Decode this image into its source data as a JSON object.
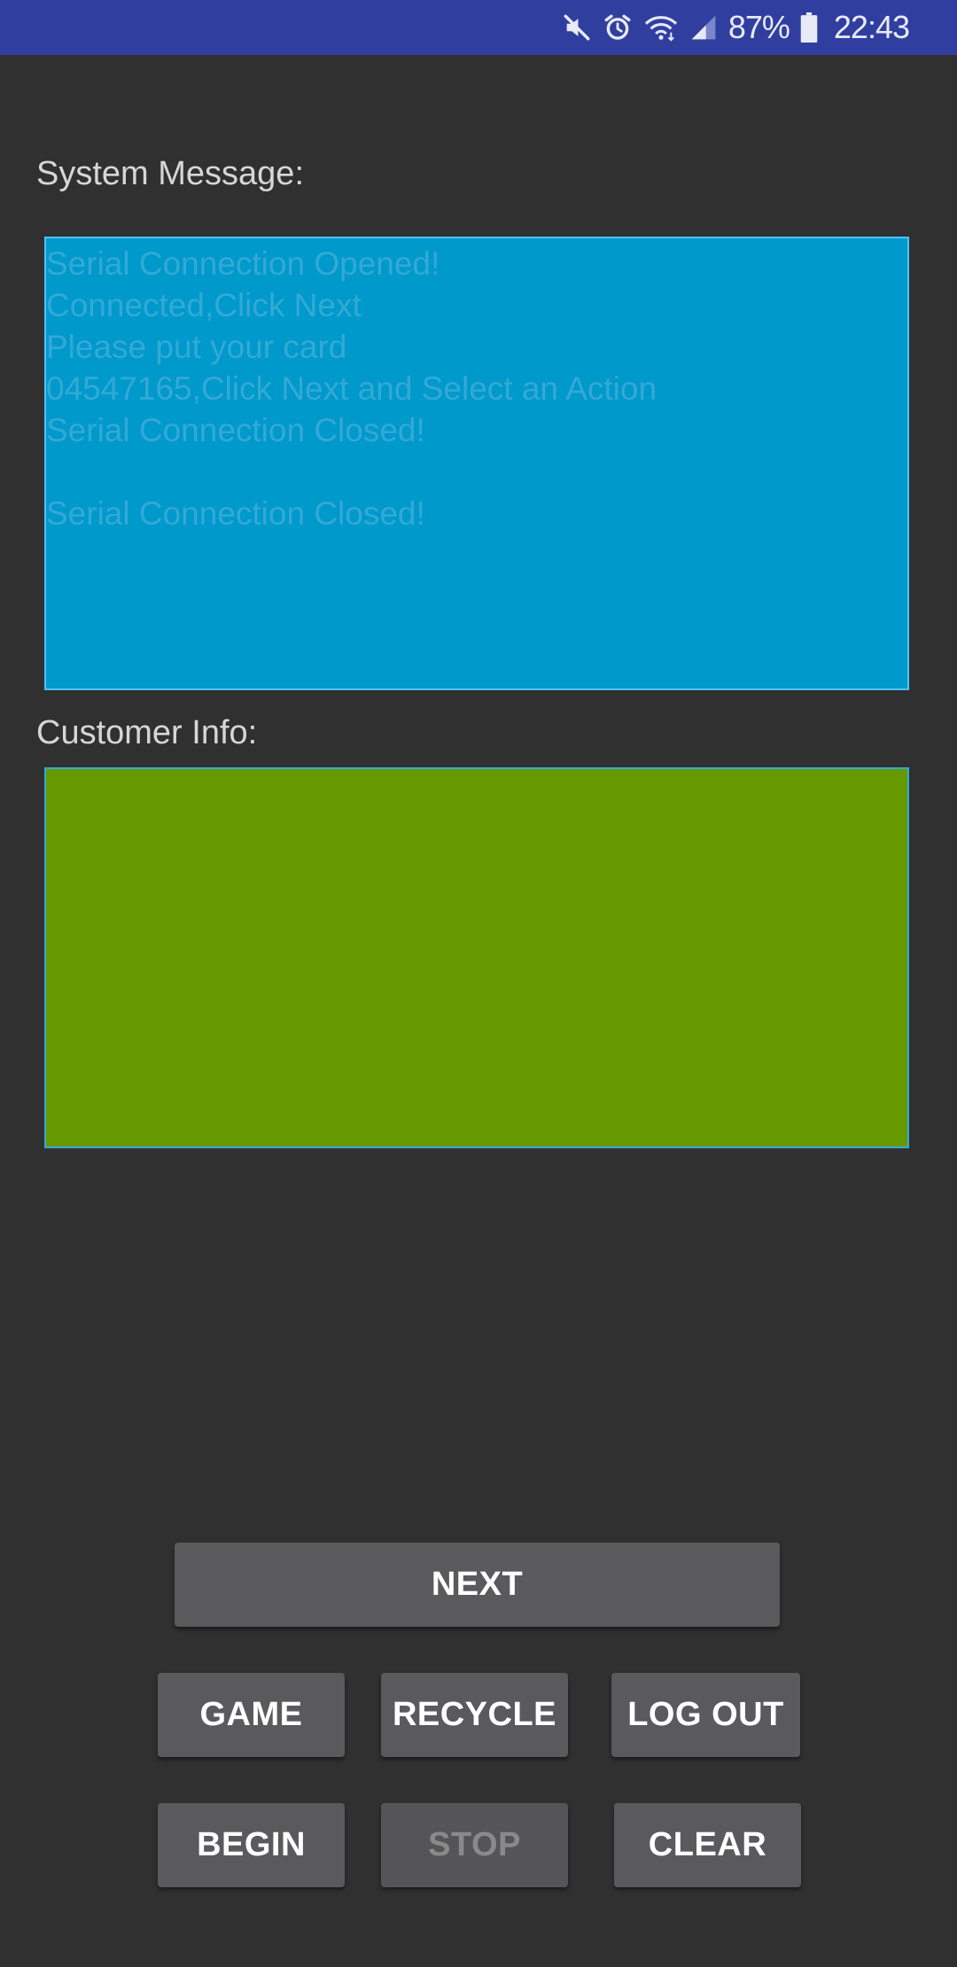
{
  "status_bar": {
    "icons": [
      "mute-icon",
      "alarm-icon",
      "wifi-icon",
      "signal-icon",
      "battery-icon"
    ],
    "battery_percent": "87%",
    "time": "22:43",
    "background_color": "#303F9F"
  },
  "system": {
    "label": "System Message:",
    "lines": [
      "Serial Connection Opened!",
      "Connected,Click Next",
      "Please put your card",
      "04547165,Click Next and Select an Action",
      "Serial Connection Closed!",
      "",
      "Serial Connection Closed!"
    ],
    "background_color": "#0099CC"
  },
  "customer": {
    "label": "Customer Info:",
    "value": "",
    "background_color": "#669900"
  },
  "buttons": {
    "next": "NEXT",
    "game": "GAME",
    "recycle": "RECYCLE",
    "logout": "LOG OUT",
    "begin": "BEGIN",
    "stop": "STOP",
    "clear": "CLEAR"
  },
  "button_states": {
    "stop_enabled": false
  }
}
